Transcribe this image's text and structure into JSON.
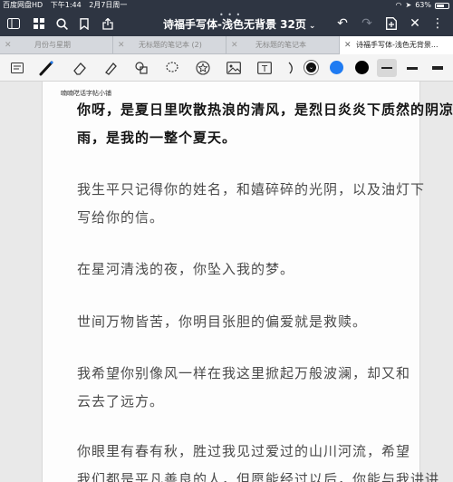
{
  "status_bar": {
    "carrier": "百度网盘HD",
    "time": "下午1:44",
    "date": "2月7日周一",
    "battery": "63%",
    "icons": [
      "wifi-icon",
      "location-icon",
      "battery-icon"
    ]
  },
  "title_bar": {
    "doc_title": "诗福手写体-浅色无背景 32页",
    "icons": [
      "sidebar-icon",
      "grid-icon",
      "search-icon",
      "bookmark-icon",
      "share-icon",
      "undo-icon",
      "redo-icon",
      "add-page-icon",
      "close-icon",
      "more-icon"
    ]
  },
  "tabs": [
    {
      "label": "月份与星期",
      "active": false
    },
    {
      "label": "无标题的笔记本 (2)",
      "active": false
    },
    {
      "label": "无标题的笔记本",
      "active": false
    },
    {
      "label": "诗福手写体-浅色无背景...",
      "active": true
    }
  ],
  "toolbar": {
    "tools": [
      "read-mode-icon",
      "pen-icon",
      "eraser-icon",
      "highlighter-icon",
      "shapes-icon",
      "lasso-icon",
      "star-icon",
      "image-icon",
      "text-icon",
      "pointer-icon"
    ],
    "colors": [
      "#111111",
      "#1f7bf2",
      "#000000"
    ],
    "selected_color": "#111111",
    "stroke_widths": [
      "thin",
      "medium",
      "thick"
    ]
  },
  "page": {
    "watermark": "喃喃呓话字帖小铺",
    "lines": [
      "你呀，是夏日里吹散热浪的清风，是烈日炎炎下质然的阴凉",
      "雨，是我的一整个夏天。",
      "我生平只记得你的姓名，和嬉碎碎的光阴，以及油灯下",
      "写给你的信。",
      "在星河清浅的夜，你坠入我的梦。",
      "世间万物皆苦，你明目张胆的偏爱就是救赎。",
      "我希望你别像风一样在我这里掀起万般波澜，却又和",
      "云去了远方。",
      "你眼里有春有秋，胜过我见过爱过的山川河流，希望",
      "我们都是平凡善良的人，但愿能经过以后，你能与我讲讲"
    ]
  }
}
